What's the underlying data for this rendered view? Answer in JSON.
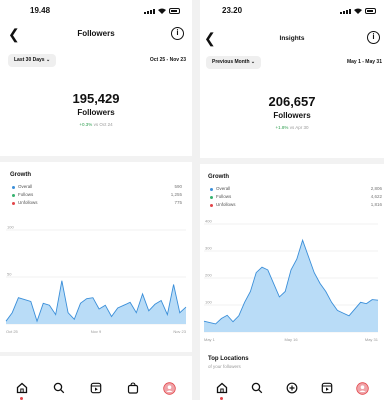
{
  "left": {
    "status_time": "19.48",
    "title": "Followers",
    "period_label": "Last 30 Days",
    "date_range": "Oct 25 - Nov 23",
    "total": "195,429",
    "total_label": "Followers",
    "delta_value": "+0.3%",
    "delta_text": "vs Oct 24",
    "growth_title": "Growth",
    "legend": [
      {
        "name": "Overall",
        "value": "590",
        "color": "#3b8fd9"
      },
      {
        "name": "Follows",
        "value": "1,255",
        "color": "#36b26f"
      },
      {
        "name": "Unfollows",
        "value": "775",
        "color": "#e2464a"
      }
    ],
    "chart_data": {
      "type": "area",
      "y_ticks": [
        "100",
        "50",
        "0"
      ],
      "x_labels": [
        "Oct 25",
        "Nov 9",
        "Nov 23"
      ],
      "ylim": [
        0,
        100
      ],
      "values": [
        3,
        12,
        28,
        26,
        24,
        3,
        22,
        20,
        10,
        46,
        12,
        5,
        22,
        27,
        28,
        16,
        20,
        8,
        17,
        20,
        23,
        12,
        32,
        14,
        21,
        25,
        10,
        42,
        12,
        18
      ]
    }
  },
  "right": {
    "status_time": "23.20",
    "title": "Insights",
    "period_label": "Previous Month",
    "date_range": "May 1 - May 31",
    "total": "206,657",
    "total_label": "Followers",
    "delta_value": "+1.8%",
    "delta_text": "vs Apr 30",
    "growth_title": "Growth",
    "legend": [
      {
        "name": "Overall",
        "value": "2,806",
        "color": "#3b8fd9"
      },
      {
        "name": "Follows",
        "value": "4,622",
        "color": "#36b26f"
      },
      {
        "name": "Unfollows",
        "value": "1,816",
        "color": "#e2464a"
      }
    ],
    "chart_data": {
      "type": "area",
      "y_ticks": [
        "400",
        "300",
        "200",
        "100",
        "0"
      ],
      "x_labels": [
        "May 1",
        "May 16",
        "May 31"
      ],
      "ylim": [
        0,
        400
      ],
      "values": [
        40,
        35,
        30,
        50,
        62,
        38,
        60,
        110,
        150,
        220,
        240,
        230,
        180,
        130,
        150,
        230,
        270,
        340,
        280,
        220,
        180,
        150,
        110,
        80,
        70,
        60,
        85,
        110,
        105,
        120,
        118
      ]
    },
    "locations_title": "Top Locations",
    "locations_sub": "of your followers"
  },
  "icons": {
    "back": "chevron-left-icon",
    "info": "info-circle-icon",
    "dropdown": "chevron-down-icon",
    "tabs": [
      "home-icon",
      "search-icon",
      "reels-icon",
      "shop-icon",
      "profile-avatar-icon"
    ]
  }
}
